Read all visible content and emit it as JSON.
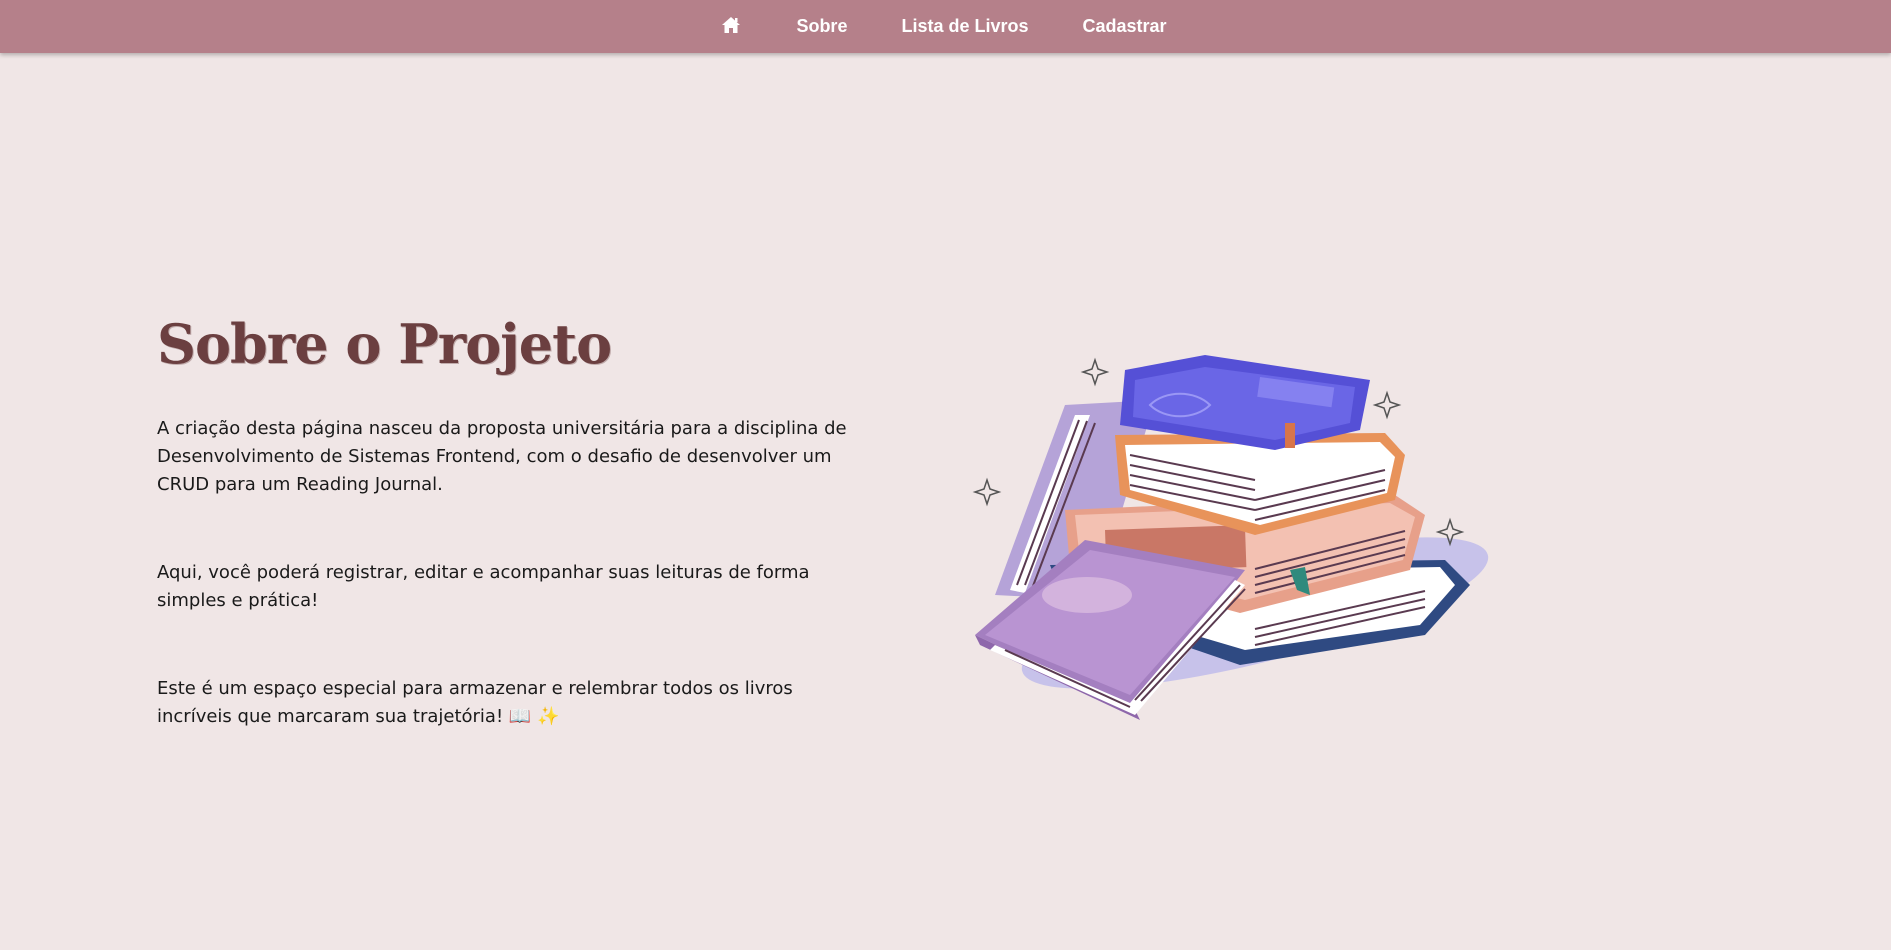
{
  "nav": {
    "home_icon": "home-icon",
    "items": [
      {
        "label": "Sobre"
      },
      {
        "label": "Lista de Livros"
      },
      {
        "label": "Cadastrar"
      }
    ]
  },
  "main": {
    "title": "Sobre o Projeto",
    "paragraphs": [
      "A criação desta página nasceu da proposta universitária para a disciplina de Desenvolvimento de Sistemas Frontend, com o desafio de desenvolver um CRUD para um Reading Journal.",
      "Aqui, você poderá registrar, editar e acompanhar suas leituras de forma simples e prática!",
      "Este é um espaço especial para armazenar e relembrar todos os livros incríveis que marcaram sua trajetória! 📖 ✨"
    ]
  },
  "illustration": {
    "icon": "book-stack-illustration"
  },
  "colors": {
    "navbar": "#b5808a",
    "background": "#f0e6e6",
    "title": "#6b3f40"
  }
}
